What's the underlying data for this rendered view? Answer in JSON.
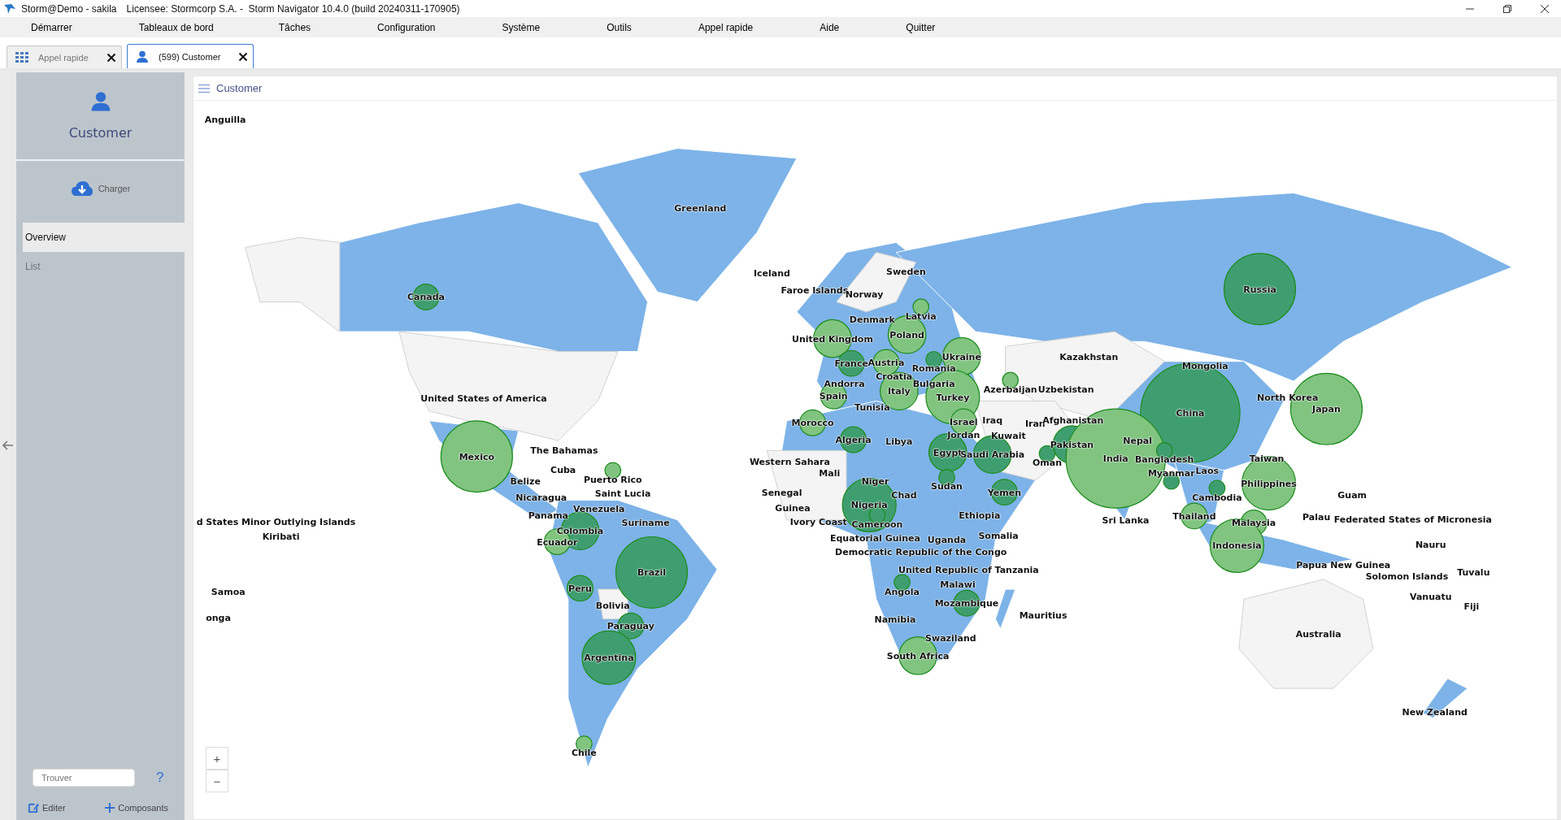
{
  "window": {
    "title": "Storm@Demo - sakila",
    "license": "Licensee: Stormcorp S.A. -  Storm Navigator 10.4.0 (build 20240311-170905)"
  },
  "menu": [
    "Démarrer",
    "Tableaux de bord",
    "Tâches",
    "Configuration",
    "Système",
    "Outils",
    "Appel rapide",
    "Aide",
    "Quitter"
  ],
  "tabs": [
    {
      "label": "Appel rapide",
      "kind": "grid",
      "selected": false
    },
    {
      "label": "(599) Customer",
      "kind": "person",
      "selected": true
    }
  ],
  "sidebar": {
    "title": "Customer",
    "load_button": "Charger",
    "items": [
      {
        "label": "Overview",
        "selected": true
      },
      {
        "label": "List",
        "selected": false
      }
    ],
    "search": {
      "placeholder": "Trouver"
    },
    "help": "?",
    "edit_button": "Editer",
    "components_button": "Composants"
  },
  "panel": {
    "title": "Customer",
    "zoom_in": "+",
    "zoom_out": "−",
    "countries": [
      {
        "name": "Anguilla"
      },
      {
        "name": "Greenland"
      },
      {
        "name": "Iceland"
      },
      {
        "name": "Sweden"
      },
      {
        "name": "Faroe Islands"
      },
      {
        "name": "Norway"
      },
      {
        "name": "Russia",
        "color": "#3f9e70"
      },
      {
        "name": "Canada",
        "color": "#3f9e70"
      },
      {
        "name": "Latvia",
        "color": "#80c480"
      },
      {
        "name": "Denmark"
      },
      {
        "name": "United Kingdom",
        "color": "#80c480"
      },
      {
        "name": "Poland",
        "color": "#80c480"
      },
      {
        "name": "France",
        "color": "#3f9e70"
      },
      {
        "name": "Austria",
        "color": "#80c480"
      },
      {
        "name": "Romania",
        "color": "#3f9e70"
      },
      {
        "name": "Ukraine",
        "color": "#80c480"
      },
      {
        "name": "Kazakhstan"
      },
      {
        "name": "Mongolia"
      },
      {
        "name": "Croatia"
      },
      {
        "name": "Andorra"
      },
      {
        "name": "Bulgaria"
      },
      {
        "name": "United States of America"
      },
      {
        "name": "Spain",
        "color": "#80c480"
      },
      {
        "name": "Italy",
        "color": "#80c480"
      },
      {
        "name": "Turkey",
        "color": "#80c480"
      },
      {
        "name": "Azerbaijan",
        "color": "#80c480"
      },
      {
        "name": "Uzbekistan"
      },
      {
        "name": "North Korea"
      },
      {
        "name": "Tunisia"
      },
      {
        "name": "China",
        "color": "#3f9e70"
      },
      {
        "name": "Japan",
        "color": "#80c480"
      },
      {
        "name": "Morocco",
        "color": "#80c480"
      },
      {
        "name": "Israel",
        "color": "#80c480"
      },
      {
        "name": "Iraq"
      },
      {
        "name": "Iran"
      },
      {
        "name": "Afghanistan"
      },
      {
        "name": "Algeria",
        "color": "#3f9e70"
      },
      {
        "name": "Libya"
      },
      {
        "name": "Jordan"
      },
      {
        "name": "Kuwait"
      },
      {
        "name": "Pakistan",
        "color": "#3f9e70"
      },
      {
        "name": "Nepal"
      },
      {
        "name": "Mexico",
        "color": "#80c480"
      },
      {
        "name": "The Bahamas"
      },
      {
        "name": "Western Sahara"
      },
      {
        "name": "Egypt",
        "color": "#3f9e70"
      },
      {
        "name": "Saudi Arabia",
        "color": "#3f9e70"
      },
      {
        "name": "Oman",
        "color": "#3f9e70"
      },
      {
        "name": "India",
        "color": "#80c480"
      },
      {
        "name": "Bangladesh",
        "color": "#3f9e70"
      },
      {
        "name": "Taiwan"
      },
      {
        "name": "Cuba"
      },
      {
        "name": "Mali"
      },
      {
        "name": "Myanmar",
        "color": "#3f9e70"
      },
      {
        "name": "Laos"
      },
      {
        "name": "Belize"
      },
      {
        "name": "Puerto Rico",
        "color": "#80c480"
      },
      {
        "name": "Niger"
      },
      {
        "name": "Sudan",
        "color": "#3f9e70"
      },
      {
        "name": "Philippines",
        "color": "#80c480"
      },
      {
        "name": "Nicaragua"
      },
      {
        "name": "Saint Lucia"
      },
      {
        "name": "Senegal"
      },
      {
        "name": "Chad"
      },
      {
        "name": "Yemen",
        "color": "#3f9e70"
      },
      {
        "name": "Cambodia",
        "color": "#3f9e70"
      },
      {
        "name": "Guam"
      },
      {
        "name": "Venezuela"
      },
      {
        "name": "Guinea"
      },
      {
        "name": "Nigeria",
        "color": "#3f9e70"
      },
      {
        "name": "d States Minor Outlying Islands"
      },
      {
        "name": "Panama"
      },
      {
        "name": "Suriname"
      },
      {
        "name": "Ivory Coast"
      },
      {
        "name": "Cameroon",
        "color": "#3f9e70"
      },
      {
        "name": "Ethiopia"
      },
      {
        "name": "Sri Lanka"
      },
      {
        "name": "Thailand",
        "color": "#80c480"
      },
      {
        "name": "Malaysia",
        "color": "#80c480"
      },
      {
        "name": "Palau"
      },
      {
        "name": "Federated States of Micronesia"
      },
      {
        "name": "Kiribati"
      },
      {
        "name": "Colombia",
        "color": "#3f9e70"
      },
      {
        "name": "Ecuador",
        "color": "#80c480"
      },
      {
        "name": "Equatorial Guinea"
      },
      {
        "name": "Uganda"
      },
      {
        "name": "Somalia"
      },
      {
        "name": "Indonesia",
        "color": "#80c480"
      },
      {
        "name": "Nauru"
      },
      {
        "name": "Democratic Republic of the Congo"
      },
      {
        "name": "Brazil",
        "color": "#3f9e70"
      },
      {
        "name": "United Republic of Tanzania"
      },
      {
        "name": "Papua New Guinea"
      },
      {
        "name": "Solomon Islands"
      },
      {
        "name": "Tuvalu"
      },
      {
        "name": "Samoa"
      },
      {
        "name": "Peru",
        "color": "#3f9e70"
      },
      {
        "name": "Angola",
        "color": "#3f9e70"
      },
      {
        "name": "Malawi"
      },
      {
        "name": "Vanuatu"
      },
      {
        "name": "Bolivia"
      },
      {
        "name": "Mozambique",
        "color": "#3f9e70"
      },
      {
        "name": "Fiji"
      },
      {
        "name": "onga"
      },
      {
        "name": "Namibia"
      },
      {
        "name": "Mauritius"
      },
      {
        "name": "Paraguay",
        "color": "#3f9e70"
      },
      {
        "name": "Swaziland"
      },
      {
        "name": "Australia"
      },
      {
        "name": "Argentina",
        "color": "#3f9e70"
      },
      {
        "name": "South Africa",
        "color": "#80c480"
      },
      {
        "name": "New Zealand"
      },
      {
        "name": "Chile",
        "color": "#80c480"
      }
    ]
  }
}
